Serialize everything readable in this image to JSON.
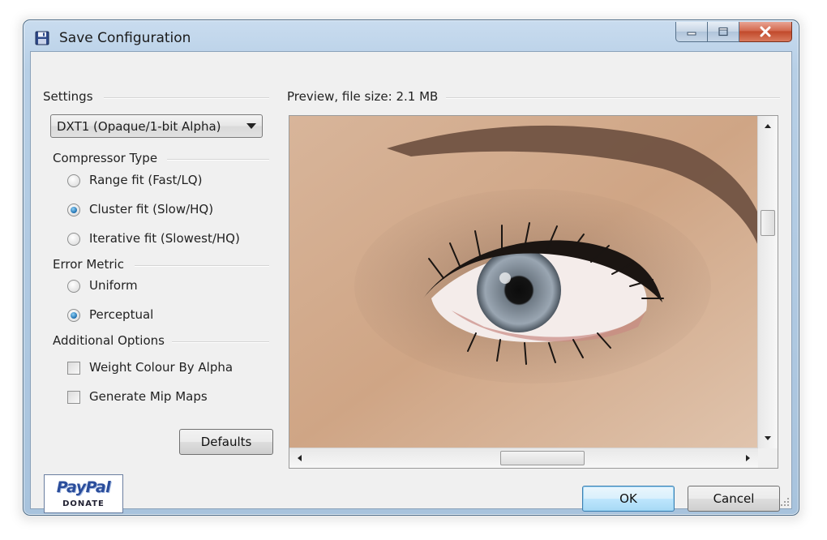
{
  "window": {
    "title": "Save Configuration",
    "icon": "floppy-disk-icon"
  },
  "settings": {
    "group_label": "Settings",
    "format_selected": "DXT1 (Opaque/1-bit Alpha)",
    "compressor": {
      "label": "Compressor Type",
      "options": [
        {
          "label": "Range fit (Fast/LQ)",
          "checked": false
        },
        {
          "label": "Cluster fit (Slow/HQ)",
          "checked": true
        },
        {
          "label": "Iterative fit (Slowest/HQ)",
          "checked": false
        }
      ]
    },
    "error_metric": {
      "label": "Error Metric",
      "options": [
        {
          "label": "Uniform",
          "checked": false
        },
        {
          "label": "Perceptual",
          "checked": true
        }
      ]
    },
    "additional": {
      "label": "Additional Options",
      "options": [
        {
          "label": "Weight Colour By Alpha",
          "checked": false
        },
        {
          "label": "Generate Mip Maps",
          "checked": false
        }
      ]
    },
    "defaults_label": "Defaults"
  },
  "preview": {
    "label": "Preview, file size: 2.1 MB",
    "image": "eye-photo"
  },
  "footer": {
    "paypal_logo": "PayPal",
    "paypal_sub": "DONATE",
    "ok_label": "OK",
    "cancel_label": "Cancel"
  },
  "colors": {
    "accent": "#3c7fb1",
    "close": "#c14a2c"
  }
}
